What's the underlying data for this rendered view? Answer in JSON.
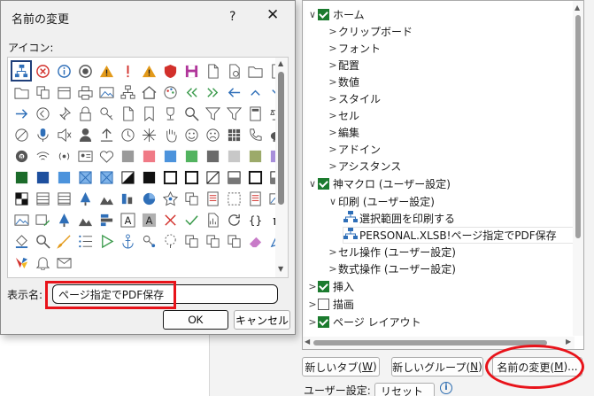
{
  "dialog": {
    "title": "名前の変更",
    "help": "?",
    "close": "✕",
    "icon_label": "アイコン:",
    "name_label": "表示名:",
    "name_value": "ページ指定でPDF保存",
    "ok_label": "OK",
    "cancel_label": "キャンセル"
  },
  "icons": [
    "macro-icon",
    "cancel-icon",
    "info-icon",
    "target-icon",
    "warning-icon",
    "exclamation-icon",
    "warning-icon",
    "shield-icon",
    "save-icon",
    "document-icon",
    "document-refresh-icon",
    "folder-icon",
    "blank-document-icon",
    "folder-icon",
    "copy-documents-icon",
    "calendar-icon",
    "printer-icon",
    "image-icon",
    "sitemap-icon",
    "home-icon",
    "palette-icon",
    "double-left-arrow-icon",
    "double-right-arrow-icon",
    "left-arrow-icon",
    "chevron-up-icon",
    "chevron-down-icon",
    "right-arrow-icon",
    "circle-left-icon",
    "pin-icon",
    "lock-icon",
    "key-icon",
    "document-icon",
    "bookmark-icon",
    "trophy-icon",
    "search-icon",
    "filter-icon",
    "filter-icon",
    "calculator-icon",
    "balance-icon",
    "block-icon",
    "microphone-icon",
    "mute-icon",
    "person-icon",
    "upload-icon",
    "clock-icon",
    "snowflake-icon",
    "hand-icon",
    "smiley-icon",
    "sad-face-icon",
    "grid-icon",
    "phone-icon",
    "piggy-bank-icon",
    "eight-ball-icon",
    "wifi-icon",
    "signal-icon",
    "id-card-icon",
    "heart-icon",
    "swatch-gray-icon",
    "swatch-pink-icon",
    "swatch-blue-icon",
    "swatch-green-icon",
    "swatch-dark-gray-icon",
    "swatch-light-gray-icon",
    "swatch-olive-icon",
    "swatch-lavender-icon",
    "swatch-dark-green-icon",
    "swatch-dark-blue-icon",
    "swatch-blue-icon",
    "pattern-icon",
    "pattern-icon",
    "diagonal-icon",
    "swatch-black-icon",
    "box-icon",
    "box-icon",
    "slash-box-icon",
    "half-box-icon",
    "box-icon",
    "half-box-icon",
    "checker-icon",
    "stripe-icon",
    "stripe-icon",
    "tree-icon",
    "mountain-icon",
    "bar-icon",
    "pie-chart-icon",
    "star-network-icon",
    "copy-icon",
    "doc-list-icon",
    "dotted-box-icon",
    "doc-list-icon",
    "image-icon",
    "image-icon",
    "image-edit-icon",
    "tree-icon",
    "mountain-icon",
    "chart-bar-icon",
    "letter-a-icon",
    "letter-a-gray-icon",
    "close-x-icon",
    "checkmark-icon",
    "document-chart-icon",
    "refresh-icon",
    "braces-icon",
    "pi-icon",
    "paint-bucket-icon",
    "search-icon",
    "brush-icon",
    "list-icon",
    "play-icon",
    "anchor-icon",
    "key-gear-icon",
    "lasso-icon",
    "copy-icon",
    "copy-icon",
    "copy-icon",
    "eraser-icon",
    "pointer-icon",
    "colors-icon",
    "bell-icon",
    "envelope-icon"
  ],
  "tree": {
    "items": [
      {
        "label": "ホーム",
        "level": 0,
        "toggle": "v",
        "checked": true
      },
      {
        "label": "クリップボード",
        "level": 1,
        "toggle": ">"
      },
      {
        "label": "フォント",
        "level": 1,
        "toggle": ">"
      },
      {
        "label": "配置",
        "level": 1,
        "toggle": ">"
      },
      {
        "label": "数値",
        "level": 1,
        "toggle": ">"
      },
      {
        "label": "スタイル",
        "level": 1,
        "toggle": ">"
      },
      {
        "label": "セル",
        "level": 1,
        "toggle": ">"
      },
      {
        "label": "編集",
        "level": 1,
        "toggle": ">"
      },
      {
        "label": "アドイン",
        "level": 1,
        "toggle": ">"
      },
      {
        "label": "アシスタンス",
        "level": 1,
        "toggle": ">"
      },
      {
        "label": "神マクロ (ユーザー設定)",
        "level": 0,
        "toggle": "v",
        "checked": true
      },
      {
        "label": "印刷 (ユーザー設定)",
        "level": 1,
        "toggle": "v"
      },
      {
        "label": "選択範囲を印刷する",
        "level": 2,
        "icon": "macro-icon"
      },
      {
        "label": "PERSONAL.XLSB!ページ指定でPDF保存",
        "level": 2,
        "icon": "macro-icon",
        "selected": true
      },
      {
        "label": "セル操作 (ユーザー設定)",
        "level": 1,
        "toggle": ">"
      },
      {
        "label": "数式操作 (ユーザー設定)",
        "level": 1,
        "toggle": ">"
      },
      {
        "label": "挿入",
        "level": 0,
        "toggle": ">",
        "checked": true
      },
      {
        "label": "描画",
        "level": 0,
        "toggle": ">",
        "checked": false
      },
      {
        "label": "ページ レイアウト",
        "level": 0,
        "toggle": ">",
        "checked": true
      }
    ]
  },
  "buttons": {
    "new_tab": "新しいタブ(",
    "new_tab_key": "W",
    "new_group": "新しいグループ(",
    "new_group_key": "N",
    "rename": "名前の変更(",
    "rename_key": "M",
    "rename_suffix": ")...",
    "close_paren": ")"
  },
  "footer": {
    "user_setting": "ユーザー設定:",
    "reset": "リセット(E)",
    "info": "i"
  },
  "colors": {
    "highlight_red": "#e8131a",
    "check_green": "#1b7b2e"
  }
}
